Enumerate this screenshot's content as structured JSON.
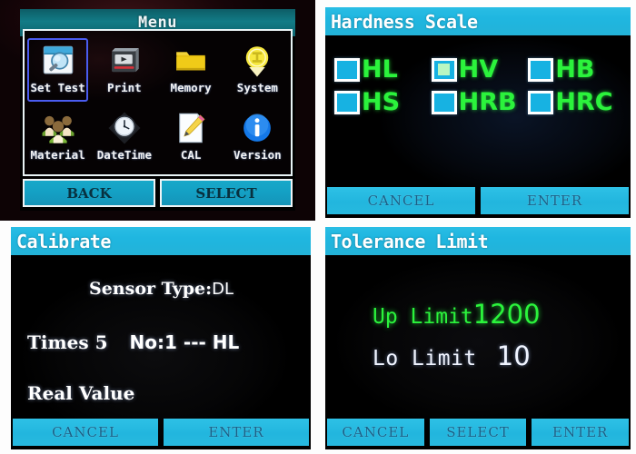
{
  "panels": {
    "menu": {
      "title": "Menu",
      "items": [
        {
          "label": "Set Test",
          "icon": "window-magnifier-icon",
          "selected": true
        },
        {
          "label": "Print",
          "icon": "printer-play-icon",
          "selected": false
        },
        {
          "label": "Memory",
          "icon": "folder-icon",
          "selected": false
        },
        {
          "label": "System",
          "icon": "lightbulb-icon",
          "selected": false
        },
        {
          "label": "Material",
          "icon": "people-group-icon",
          "selected": false
        },
        {
          "label": "DateTime",
          "icon": "clock-icon",
          "selected": false
        },
        {
          "label": "CAL",
          "icon": "paper-pencil-icon",
          "selected": false
        },
        {
          "label": "Version",
          "icon": "info-circle-icon",
          "selected": false
        }
      ],
      "buttons": [
        "BACK",
        "SELECT"
      ]
    },
    "hardness": {
      "title": "Hardness Scale",
      "options": [
        {
          "label": "HL",
          "checked": false
        },
        {
          "label": "HV",
          "checked": true
        },
        {
          "label": "HB",
          "checked": false
        },
        {
          "label": "HS",
          "checked": false
        },
        {
          "label": "HRB",
          "checked": false
        },
        {
          "label": "HRC",
          "checked": false
        }
      ],
      "buttons": [
        "CANCEL",
        "ENTER"
      ]
    },
    "calibrate": {
      "title": "Calibrate",
      "sensor_label": "Sensor Type:",
      "sensor_value": "DL",
      "times_label": "Times",
      "times_value": "5",
      "no_text": "No:1 --- HL",
      "real_value_label": "Real Value",
      "buttons": [
        "CANCEL",
        "ENTER"
      ]
    },
    "tolerance": {
      "title": "Tolerance Limit",
      "up_label": "Up Limit",
      "up_value": "1200",
      "lo_label": "Lo Limit",
      "lo_value": "10",
      "buttons": [
        "CANCEL",
        "SELECT",
        "ENTER"
      ]
    }
  },
  "colors": {
    "header_teal": "#127b86",
    "header_cyan": "#22b6de",
    "button_cyan": "#22b6de",
    "green_text": "#2bf33c",
    "white_text": "#f0f4ff",
    "selection_border": "#4a5cf0",
    "checkbox_fill": "#17b2e2"
  }
}
